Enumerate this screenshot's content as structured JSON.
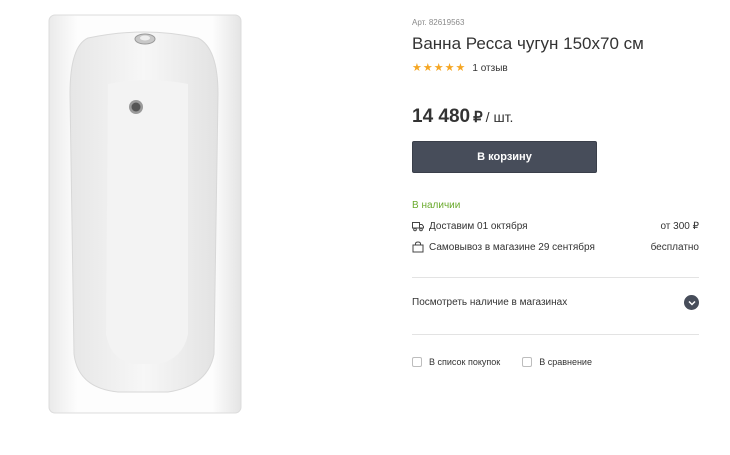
{
  "product": {
    "article": "Арт. 82619563",
    "title": "Ванна Ресса чугун 150x70 см",
    "rating_stars": 5,
    "reviews": "1 отзыв",
    "price": "14 480",
    "currency": "₽",
    "unit": "/ шт.",
    "image_icon": "bathtub-image"
  },
  "cart": {
    "label": "В корзину"
  },
  "availability": {
    "status": "В наличии",
    "delivery_label": "Доставим 01 октября",
    "delivery_value": "от 300 ₽",
    "pickup_label": "Самовывоз в магазине 29 сентября",
    "pickup_value": "бесплатно"
  },
  "stores": {
    "label": "Посмотреть наличие в магазинах"
  },
  "actions": {
    "shopping_list": "В список покупок",
    "compare": "В сравнение"
  },
  "colors": {
    "button": "#474d5a",
    "in_stock": "#6aaa2d",
    "star": "#f5a623"
  }
}
